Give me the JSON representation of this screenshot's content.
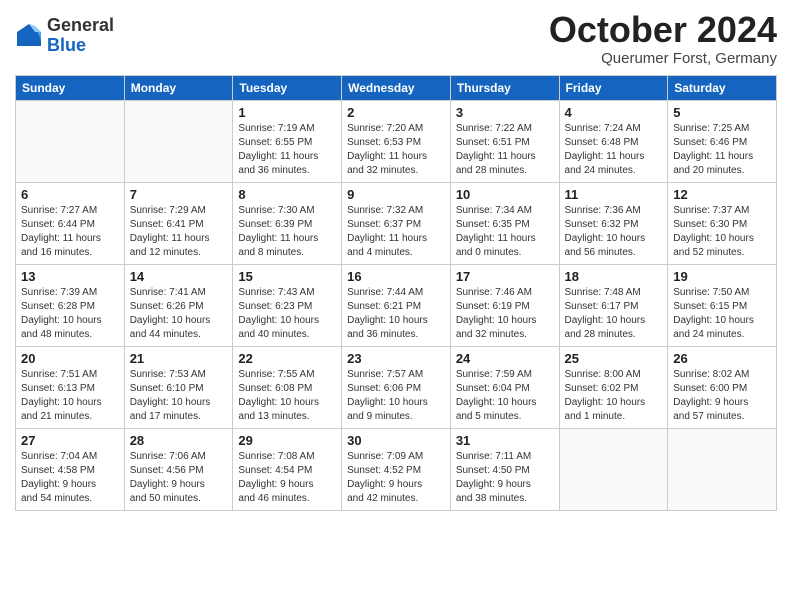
{
  "header": {
    "logo_line1": "General",
    "logo_line2": "Blue",
    "month": "October 2024",
    "location": "Querumer Forst, Germany"
  },
  "weekdays": [
    "Sunday",
    "Monday",
    "Tuesday",
    "Wednesday",
    "Thursday",
    "Friday",
    "Saturday"
  ],
  "weeks": [
    [
      {
        "day": "",
        "detail": ""
      },
      {
        "day": "",
        "detail": ""
      },
      {
        "day": "1",
        "detail": "Sunrise: 7:19 AM\nSunset: 6:55 PM\nDaylight: 11 hours\nand 36 minutes."
      },
      {
        "day": "2",
        "detail": "Sunrise: 7:20 AM\nSunset: 6:53 PM\nDaylight: 11 hours\nand 32 minutes."
      },
      {
        "day": "3",
        "detail": "Sunrise: 7:22 AM\nSunset: 6:51 PM\nDaylight: 11 hours\nand 28 minutes."
      },
      {
        "day": "4",
        "detail": "Sunrise: 7:24 AM\nSunset: 6:48 PM\nDaylight: 11 hours\nand 24 minutes."
      },
      {
        "day": "5",
        "detail": "Sunrise: 7:25 AM\nSunset: 6:46 PM\nDaylight: 11 hours\nand 20 minutes."
      }
    ],
    [
      {
        "day": "6",
        "detail": "Sunrise: 7:27 AM\nSunset: 6:44 PM\nDaylight: 11 hours\nand 16 minutes."
      },
      {
        "day": "7",
        "detail": "Sunrise: 7:29 AM\nSunset: 6:41 PM\nDaylight: 11 hours\nand 12 minutes."
      },
      {
        "day": "8",
        "detail": "Sunrise: 7:30 AM\nSunset: 6:39 PM\nDaylight: 11 hours\nand 8 minutes."
      },
      {
        "day": "9",
        "detail": "Sunrise: 7:32 AM\nSunset: 6:37 PM\nDaylight: 11 hours\nand 4 minutes."
      },
      {
        "day": "10",
        "detail": "Sunrise: 7:34 AM\nSunset: 6:35 PM\nDaylight: 11 hours\nand 0 minutes."
      },
      {
        "day": "11",
        "detail": "Sunrise: 7:36 AM\nSunset: 6:32 PM\nDaylight: 10 hours\nand 56 minutes."
      },
      {
        "day": "12",
        "detail": "Sunrise: 7:37 AM\nSunset: 6:30 PM\nDaylight: 10 hours\nand 52 minutes."
      }
    ],
    [
      {
        "day": "13",
        "detail": "Sunrise: 7:39 AM\nSunset: 6:28 PM\nDaylight: 10 hours\nand 48 minutes."
      },
      {
        "day": "14",
        "detail": "Sunrise: 7:41 AM\nSunset: 6:26 PM\nDaylight: 10 hours\nand 44 minutes."
      },
      {
        "day": "15",
        "detail": "Sunrise: 7:43 AM\nSunset: 6:23 PM\nDaylight: 10 hours\nand 40 minutes."
      },
      {
        "day": "16",
        "detail": "Sunrise: 7:44 AM\nSunset: 6:21 PM\nDaylight: 10 hours\nand 36 minutes."
      },
      {
        "day": "17",
        "detail": "Sunrise: 7:46 AM\nSunset: 6:19 PM\nDaylight: 10 hours\nand 32 minutes."
      },
      {
        "day": "18",
        "detail": "Sunrise: 7:48 AM\nSunset: 6:17 PM\nDaylight: 10 hours\nand 28 minutes."
      },
      {
        "day": "19",
        "detail": "Sunrise: 7:50 AM\nSunset: 6:15 PM\nDaylight: 10 hours\nand 24 minutes."
      }
    ],
    [
      {
        "day": "20",
        "detail": "Sunrise: 7:51 AM\nSunset: 6:13 PM\nDaylight: 10 hours\nand 21 minutes."
      },
      {
        "day": "21",
        "detail": "Sunrise: 7:53 AM\nSunset: 6:10 PM\nDaylight: 10 hours\nand 17 minutes."
      },
      {
        "day": "22",
        "detail": "Sunrise: 7:55 AM\nSunset: 6:08 PM\nDaylight: 10 hours\nand 13 minutes."
      },
      {
        "day": "23",
        "detail": "Sunrise: 7:57 AM\nSunset: 6:06 PM\nDaylight: 10 hours\nand 9 minutes."
      },
      {
        "day": "24",
        "detail": "Sunrise: 7:59 AM\nSunset: 6:04 PM\nDaylight: 10 hours\nand 5 minutes."
      },
      {
        "day": "25",
        "detail": "Sunrise: 8:00 AM\nSunset: 6:02 PM\nDaylight: 10 hours\nand 1 minute."
      },
      {
        "day": "26",
        "detail": "Sunrise: 8:02 AM\nSunset: 6:00 PM\nDaylight: 9 hours\nand 57 minutes."
      }
    ],
    [
      {
        "day": "27",
        "detail": "Sunrise: 7:04 AM\nSunset: 4:58 PM\nDaylight: 9 hours\nand 54 minutes."
      },
      {
        "day": "28",
        "detail": "Sunrise: 7:06 AM\nSunset: 4:56 PM\nDaylight: 9 hours\nand 50 minutes."
      },
      {
        "day": "29",
        "detail": "Sunrise: 7:08 AM\nSunset: 4:54 PM\nDaylight: 9 hours\nand 46 minutes."
      },
      {
        "day": "30",
        "detail": "Sunrise: 7:09 AM\nSunset: 4:52 PM\nDaylight: 9 hours\nand 42 minutes."
      },
      {
        "day": "31",
        "detail": "Sunrise: 7:11 AM\nSunset: 4:50 PM\nDaylight: 9 hours\nand 38 minutes."
      },
      {
        "day": "",
        "detail": ""
      },
      {
        "day": "",
        "detail": ""
      }
    ]
  ]
}
